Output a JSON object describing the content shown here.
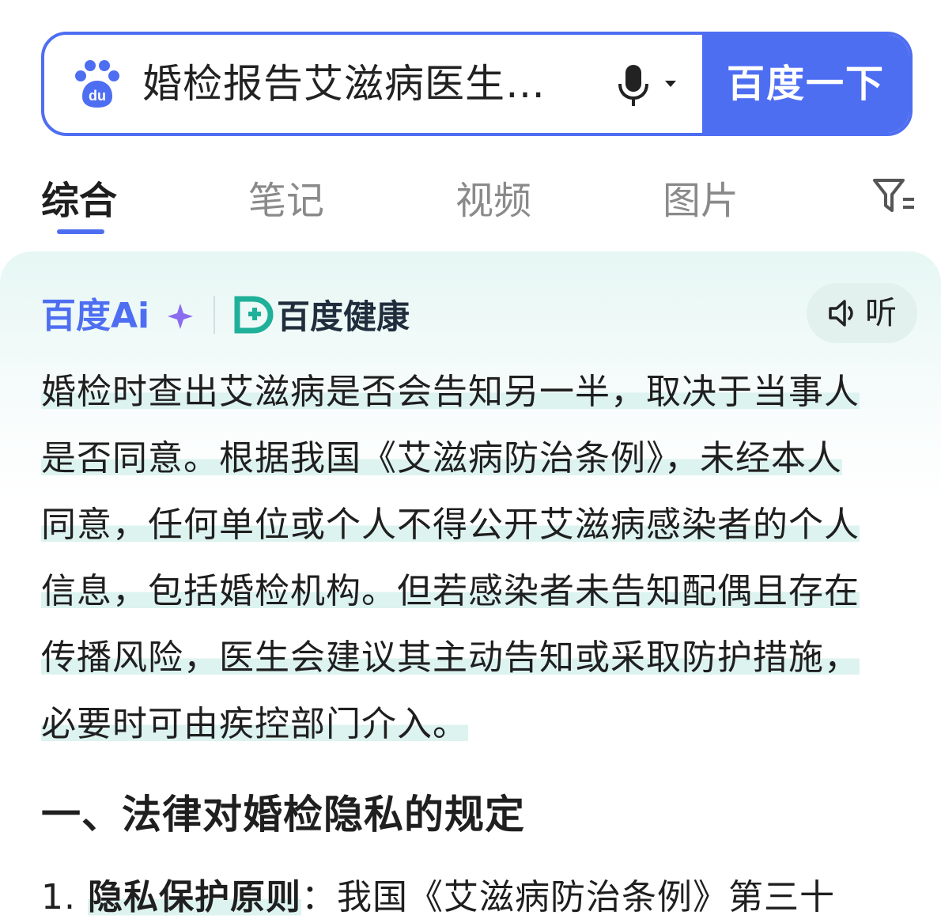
{
  "search": {
    "query": "婚检报告艾滋病医生…",
    "button_label": "百度一下",
    "logo_text": "du"
  },
  "tabs": [
    {
      "label": "综合",
      "active": true
    },
    {
      "label": "笔记",
      "active": false
    },
    {
      "label": "视频",
      "active": false
    },
    {
      "label": "图片",
      "active": false
    }
  ],
  "ai_card": {
    "brand_ai": "百度Ai",
    "brand_health": "百度健康",
    "listen_label": "听",
    "answer_lines": [
      "婚检时查出艾滋病是否会告知另一半，取决于当事人",
      "是否同意。根据我国《艾滋病防治条例》，未经本人",
      "同意，任何单位或个人不得公开艾滋病感染者的个人",
      "信息，包括婚检机构。但若感染者未告知配偶且存在",
      "传播风险，医生会建议其主动告知或采取防护措施，",
      "必要时可由疾控部门介入。"
    ],
    "section_title": "一、法律对婚检隐私的规定",
    "item1_number": "1.",
    "item1_term": "隐私保护原则",
    "item1_text": "：我国《艾滋病防治条例》第三十"
  },
  "colors": {
    "accent": "#4e6ef2",
    "highlight": "#ddf3ef",
    "health_teal": "#1fb09a"
  }
}
